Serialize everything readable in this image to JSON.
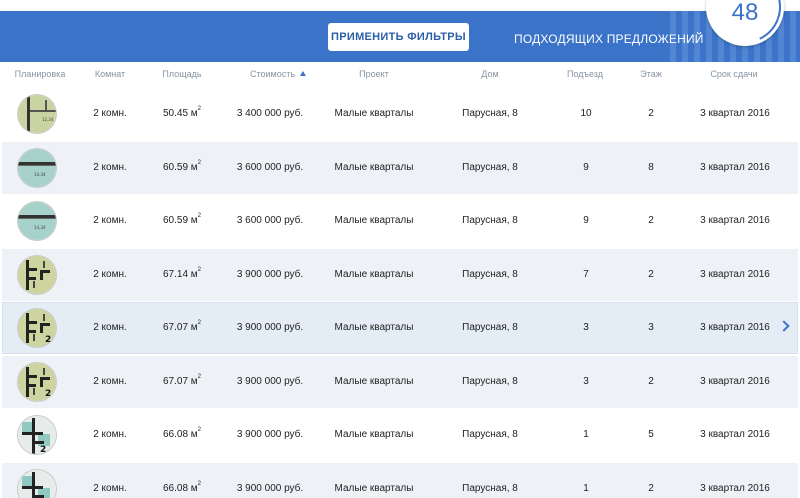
{
  "filter_bar": {
    "apply_button_label": "ПРИМЕНИТЬ ФИЛЬТРЫ",
    "results_label": "ПОДХОДЯЩИХ ПРЕДЛОЖЕНИЙ",
    "results_count": "48",
    "bar_color": "#3a73c8"
  },
  "table": {
    "columns": [
      "Планировка",
      "Комнат",
      "Площадь",
      "Стоимость",
      "Проект",
      "Дом",
      "Подъезд",
      "Этаж",
      "Срок сдачи"
    ],
    "sort_column": "Стоимость",
    "sort_direction": "ascending",
    "rows": [
      {
        "plan_label": "12,24",
        "plan_style": "plan-a",
        "rooms": "2 комн.",
        "area": "50.45",
        "area_unit": "м",
        "area_exp": "2",
        "price": "3 400 000 руб.",
        "project": "Малые кварталы",
        "house": "Парусная, 8",
        "entrance": "10",
        "floor": "2",
        "deadline": "3 квартал 2016"
      },
      {
        "plan_label": "14,34",
        "plan_style": "plan-b",
        "rooms": "2 комн.",
        "area": "60.59",
        "area_unit": "м",
        "area_exp": "2",
        "price": "3 600 000 руб.",
        "project": "Малые кварталы",
        "house": "Парусная, 8",
        "entrance": "9",
        "floor": "8",
        "deadline": "3 квартал 2016"
      },
      {
        "plan_label": "14,34",
        "plan_style": "plan-b",
        "rooms": "2 комн.",
        "area": "60.59",
        "area_unit": "м",
        "area_exp": "2",
        "price": "3 600 000 руб.",
        "project": "Малые кварталы",
        "house": "Парусная, 8",
        "entrance": "9",
        "floor": "2",
        "deadline": "3 квартал 2016"
      },
      {
        "plan_label": "",
        "plan_style": "plan-c",
        "rooms": "2 комн.",
        "area": "67.14",
        "area_unit": "м",
        "area_exp": "2",
        "price": "3 900 000 руб.",
        "project": "Малые кварталы",
        "house": "Парусная, 8",
        "entrance": "7",
        "floor": "2",
        "deadline": "3 квартал 2016"
      },
      {
        "plan_label": "2",
        "plan_style": "plan-c",
        "rooms": "2 комн.",
        "area": "67.07",
        "area_unit": "м",
        "area_exp": "2",
        "price": "3 900 000 руб.",
        "project": "Малые кварталы",
        "house": "Парусная, 8",
        "entrance": "3",
        "floor": "3",
        "deadline": "3 квартал 2016"
      },
      {
        "plan_label": "2",
        "plan_style": "plan-c",
        "rooms": "2 комн.",
        "area": "67.07",
        "area_unit": "м",
        "area_exp": "2",
        "price": "3 900 000 руб.",
        "project": "Малые кварталы",
        "house": "Парусная, 8",
        "entrance": "3",
        "floor": "2",
        "deadline": "3 квартал 2016"
      },
      {
        "plan_label": "2",
        "plan_style": "plan-d",
        "rooms": "2 комн.",
        "area": "66.08",
        "area_unit": "м",
        "area_exp": "2",
        "price": "3 900 000 руб.",
        "project": "Малые кварталы",
        "house": "Парусная, 8",
        "entrance": "1",
        "floor": "5",
        "deadline": "3 квартал 2016"
      },
      {
        "plan_label": "",
        "plan_style": "plan-d",
        "rooms": "2 комн.",
        "area": "66.08",
        "area_unit": "м",
        "area_exp": "2",
        "price": "3 900 000 руб.",
        "project": "Малые кварталы",
        "house": "Парусная, 8",
        "entrance": "1",
        "floor": "2",
        "deadline": "3 квартал 2016"
      }
    ],
    "active_row": 4,
    "row_action_icon": "chevron-right-icon"
  }
}
